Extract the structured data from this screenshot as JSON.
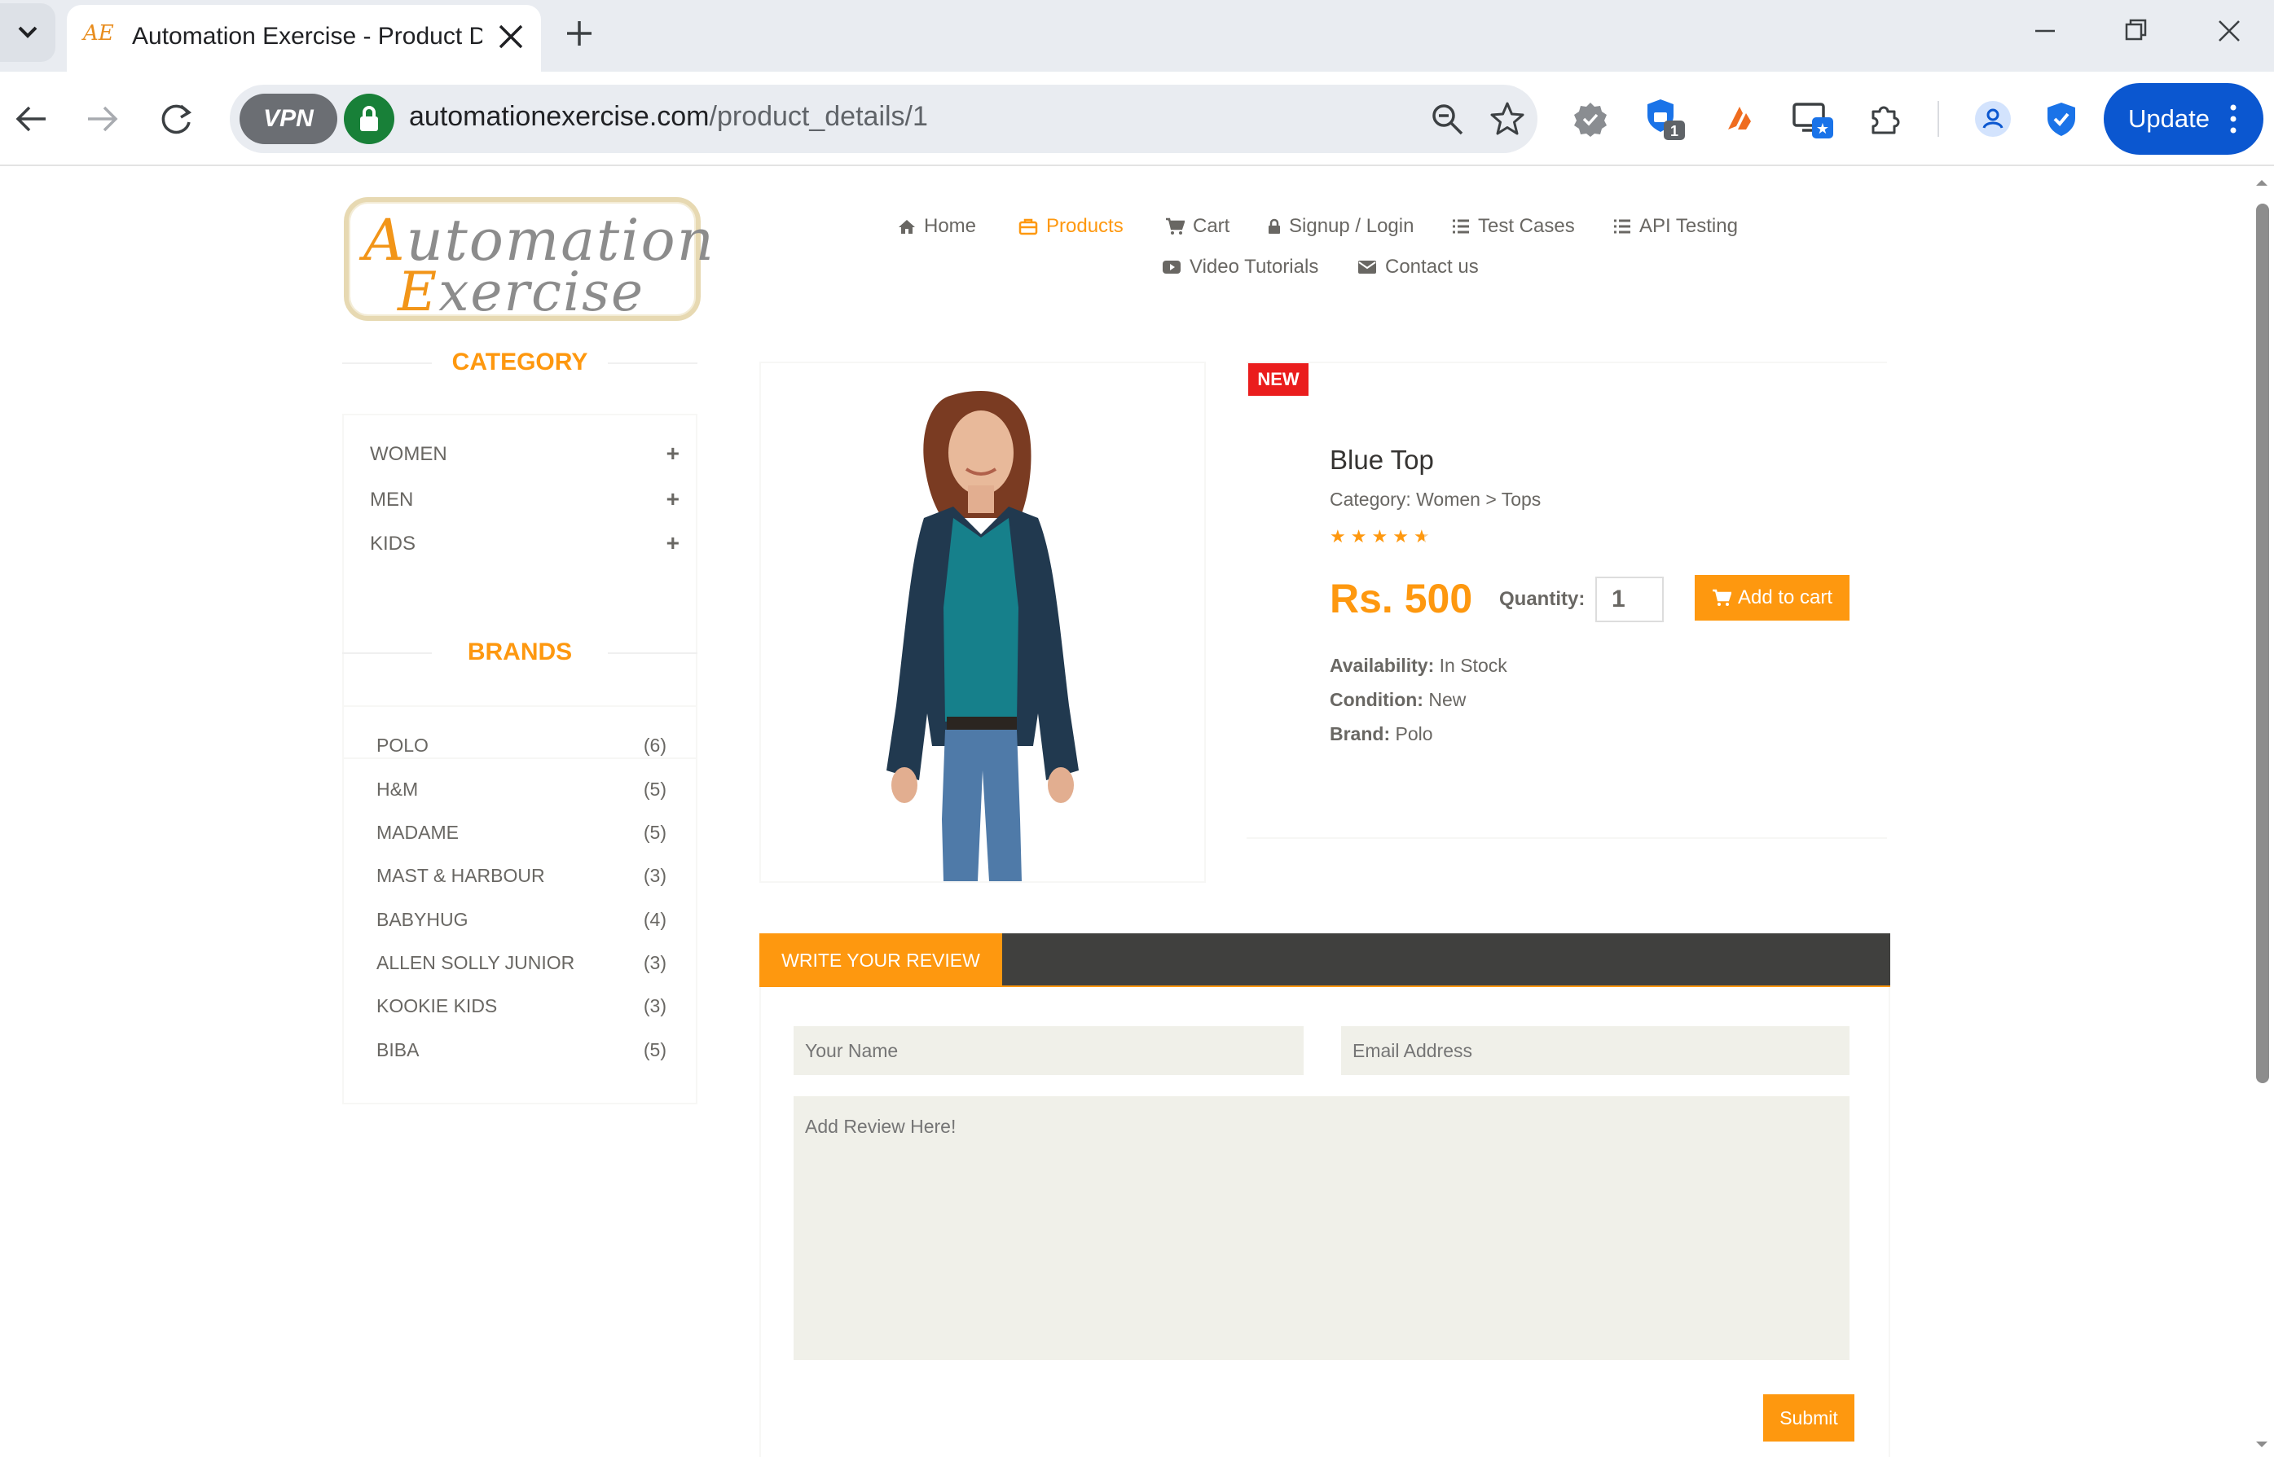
{
  "browser": {
    "tab_title": "Automation Exercise - Product Details",
    "favicon_text": "AE",
    "url_host": "automationexercise.com",
    "url_path": "/product_details/1",
    "vpn_label": "VPN",
    "update_label": "Update",
    "extension_badge": "1"
  },
  "nav": {
    "home": "Home",
    "products": "Products",
    "cart": "Cart",
    "signup": "Signup / Login",
    "test_cases": "Test Cases",
    "api_testing": "API Testing",
    "video_tutorials": "Video Tutorials",
    "contact": "Contact us"
  },
  "logo": {
    "line1_cap": "A",
    "line1_rest": "utomation",
    "line2_cap": "E",
    "line2_rest": "xercise"
  },
  "category": {
    "title": "CATEGORY",
    "items": [
      {
        "label": "WOMEN"
      },
      {
        "label": "MEN"
      },
      {
        "label": "KIDS"
      }
    ],
    "expand_symbol": "+"
  },
  "brands": {
    "title": "BRANDS",
    "items": [
      {
        "name": "POLO",
        "count": "(6)"
      },
      {
        "name": "H&M",
        "count": "(5)"
      },
      {
        "name": "MADAME",
        "count": "(5)"
      },
      {
        "name": "MAST & HARBOUR",
        "count": "(3)"
      },
      {
        "name": "BABYHUG",
        "count": "(4)"
      },
      {
        "name": "ALLEN SOLLY JUNIOR",
        "count": "(3)"
      },
      {
        "name": "KOOKIE KIDS",
        "count": "(3)"
      },
      {
        "name": "BIBA",
        "count": "(5)"
      }
    ]
  },
  "product": {
    "badge": "NEW",
    "name": "Blue Top",
    "category": "Category: Women > Tops",
    "rating": 4.5,
    "price": "Rs. 500",
    "quantity_label": "Quantity:",
    "quantity_value": "1",
    "add_to_cart": "Add to cart",
    "availability_label": "Availability:",
    "availability_value": "In Stock",
    "condition_label": "Condition:",
    "condition_value": "New",
    "brand_label": "Brand:",
    "brand_value": "Polo"
  },
  "review": {
    "tab_label": "WRITE YOUR REVIEW",
    "name_placeholder": "Your Name",
    "email_placeholder": "Email Address",
    "review_placeholder": "Add Review Here!",
    "submit_label": "Submit"
  },
  "colors": {
    "accent": "#fe980f",
    "new_badge": "#ea1d1d",
    "tab_bar": "#40403e",
    "field_bg": "#f0f0e9",
    "browser_blue": "#0b57d0"
  }
}
